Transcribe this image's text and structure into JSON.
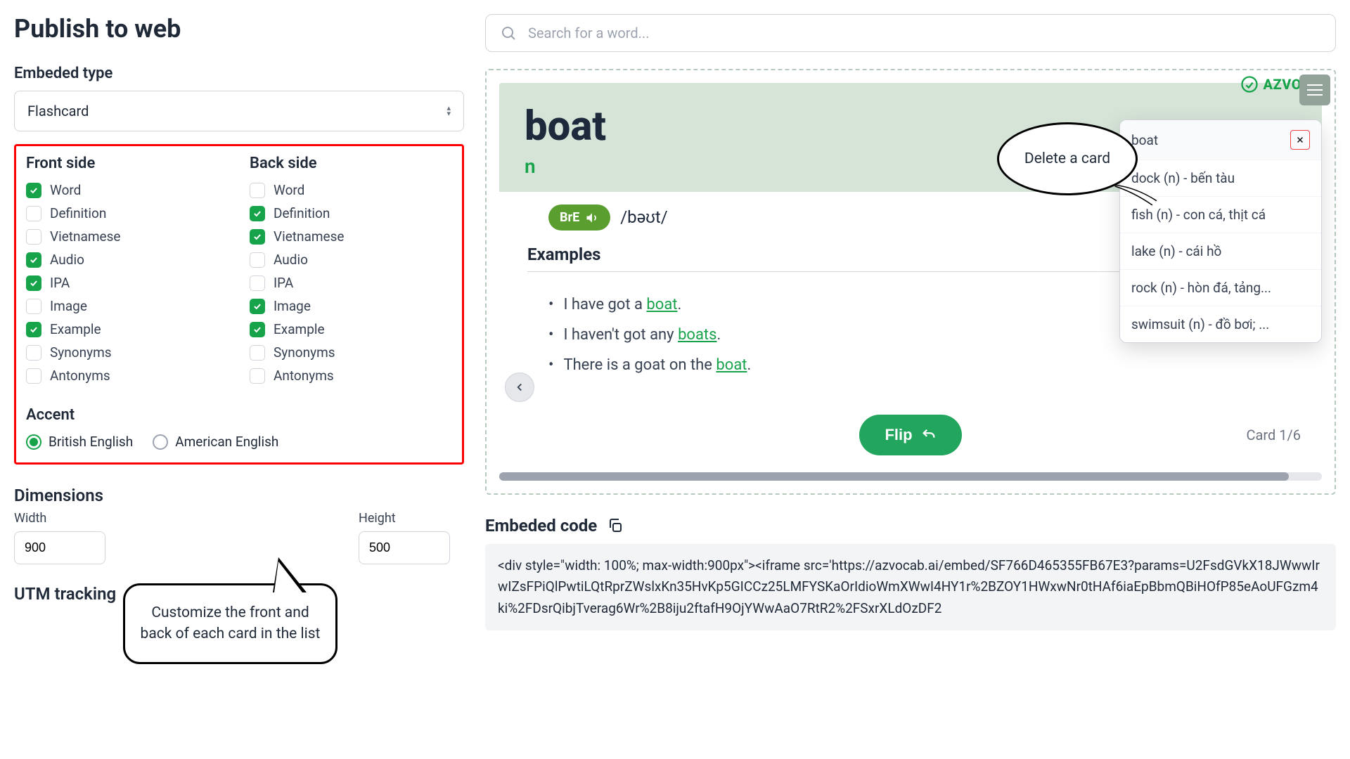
{
  "page_title": "Publish to web",
  "embed_type_label": "Embeded type",
  "embed_type_value": "Flashcard",
  "front_side_title": "Front side",
  "back_side_title": "Back side",
  "options": {
    "word": "Word",
    "definition": "Definition",
    "vietnamese": "Vietnamese",
    "audio": "Audio",
    "ipa": "IPA",
    "image": "Image",
    "example": "Example",
    "synonyms": "Synonyms",
    "antonyms": "Antonyms"
  },
  "front_checked": {
    "word": true,
    "definition": false,
    "vietnamese": false,
    "audio": true,
    "ipa": true,
    "image": false,
    "example": true,
    "synonyms": false,
    "antonyms": false
  },
  "back_checked": {
    "word": false,
    "definition": true,
    "vietnamese": true,
    "audio": false,
    "ipa": false,
    "image": true,
    "example": true,
    "synonyms": false,
    "antonyms": false
  },
  "accent_title": "Accent",
  "accent_options": {
    "bre": "British English",
    "ame": "American English"
  },
  "accent_selected": "bre",
  "dimensions_title": "Dimensions",
  "width_label": "Width",
  "height_label": "Height",
  "width_value": "900",
  "height_value": "500",
  "utm_title": "UTM tracking",
  "callout_customize": "Customize the front and back of each card in the list",
  "search_placeholder": "Search for a word...",
  "card": {
    "word": "boat",
    "pos": "n",
    "accent_badge": "BrE",
    "ipa": "/bəʊt/",
    "examples_title": "Examples",
    "examples": [
      {
        "pre": "I have got a ",
        "hw": "boat",
        "post": "."
      },
      {
        "pre": "I haven't got any ",
        "hw": "boats",
        "post": "."
      },
      {
        "pre": "There is a goat on the ",
        "hw": "boat",
        "post": "."
      }
    ],
    "flip_label": "Flip",
    "counter": "Card 1/6",
    "brand": "AZVOCAB"
  },
  "dropdown_items": [
    "boat",
    "dock (n) - bến tàu",
    "fish (n) - con cá, thịt cá",
    "lake (n) - cái hồ",
    "rock (n) - hòn đá, tảng...",
    "swimsuit (n) - đồ bơi; ..."
  ],
  "callout_delete": "Delete a card",
  "embed_code_label": "Embeded code",
  "embed_code": "<div style=\"width: 100%; max-width:900px\"><iframe src='https://azvocab.ai/embed/SF766D465355FB67E3?params=U2FsdGVkX18JWwwIrwIZsFPiQlPwtiLQtRprZWslxKn35HvKp5GICCz25LMFYSKaOrIdioWmXWwI4HY1r%2BZOY1HWxwNr0tHAf6iaEpBbmQBiHOfP85eAoUFGzm4ki%2FDsrQibjTverag6Wr%2B8iju2ftafH9OjYWwAaO7RtR2%2FSxrXLdOzDF2"
}
